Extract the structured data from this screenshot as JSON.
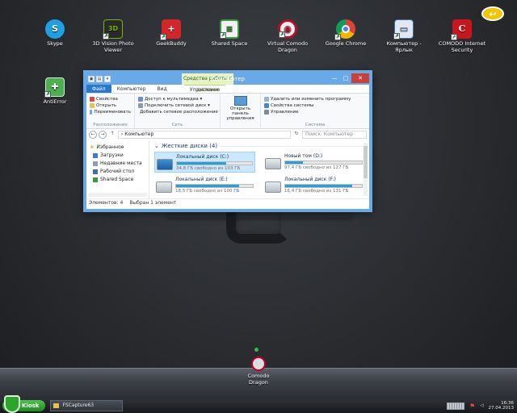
{
  "desktop": {
    "icons": [
      {
        "label": "Skype",
        "icon": "skype-icon",
        "color": "#1fa0e3",
        "glyph": "S"
      },
      {
        "label": "3D Vision Photo Viewer",
        "icon": "nvidia-3d-vision-icon",
        "color": "#2a2a2a",
        "glyph": "3D"
      },
      {
        "label": "GeekBuddy",
        "icon": "geekbuddy-icon",
        "color": "#d1262a",
        "glyph": "+"
      },
      {
        "label": "Shared Space",
        "icon": "shared-space-icon",
        "color": "#3a9a3a",
        "glyph": "≡"
      },
      {
        "label": "Virtual Comodo Dragon",
        "icon": "comodo-dragon-icon",
        "color": "#b3122a",
        "glyph": "◉"
      },
      {
        "label": "Google Chrome",
        "icon": "chrome-icon",
        "color": "#e8a31c",
        "glyph": "◎"
      },
      {
        "label": "Компьютер - Ярлык",
        "icon": "computer-shortcut-icon",
        "color": "#3d6fb4",
        "glyph": "▭"
      },
      {
        "label": "COMODO Internet Security",
        "icon": "comodo-security-icon",
        "color": "#c8161d",
        "glyph": "C"
      },
      {
        "label": "AntiError",
        "icon": "antierror-icon",
        "color": "#4caf50",
        "glyph": "✚"
      }
    ],
    "back_glyph": "↩"
  },
  "window": {
    "title": "Компьютер",
    "context_tab": "Средства работы с дисками",
    "controls": {
      "minimize": "—",
      "maximize": "□",
      "close": "✕"
    },
    "tabs": [
      "Файл",
      "Компьютер",
      "Вид",
      "Управление"
    ],
    "ribbon": {
      "groups": [
        {
          "label": "Расположение",
          "commands": [
            "Свойства",
            "Открыть",
            "Переименовать"
          ]
        },
        {
          "label": "Сеть",
          "commands": [
            "Доступ к мультимедиа ▾",
            "Подключить сетевой диск ▾",
            "Добавить сетевое расположение"
          ]
        },
        {
          "label": "",
          "big_command": "Открыть панель управления"
        },
        {
          "label": "Система",
          "commands": [
            "Удалить или изменить программу",
            "Свойства системы",
            "Управление"
          ]
        }
      ]
    },
    "address": {
      "back": "←",
      "forward": "→",
      "up": "↑",
      "path": "› Компьютер",
      "refresh": "↻",
      "search_placeholder": "Поиск: Компьютер"
    },
    "nav": {
      "favorites": "Избранное",
      "items": [
        "Загрузки",
        "Недавние места",
        "Рабочий стол",
        "Shared Space"
      ]
    },
    "section_title": "Жесткие диски (4)",
    "drives": [
      {
        "name": "Локальный диск (C:)",
        "free": "34,8 ГБ свободно из 103 ГБ",
        "used_fraction": 0.66,
        "selected": true,
        "system": true
      },
      {
        "name": "Новый том (D:)",
        "free": "97,4 ГБ свободно из 127 ГБ",
        "used_fraction": 0.23,
        "selected": false,
        "system": false
      },
      {
        "name": "Локальный диск (E:)",
        "free": "18,5 ГБ свободно из 100 ГБ",
        "used_fraction": 0.82,
        "selected": false,
        "system": false
      },
      {
        "name": "Локальный диск (F:)",
        "free": "16,4 ГБ свободно из 131 ГБ",
        "used_fraction": 0.87,
        "selected": false,
        "system": false
      }
    ],
    "status": {
      "count": "Элементов: 4",
      "selected": "Выбран 1 элемент"
    }
  },
  "dock": {
    "item_label": "Comodo Dragon"
  },
  "taskbar": {
    "start_label": "Kiosk",
    "task_label": "FSCapture63",
    "clock_time": "16:36",
    "clock_date": "27.04.2013"
  }
}
